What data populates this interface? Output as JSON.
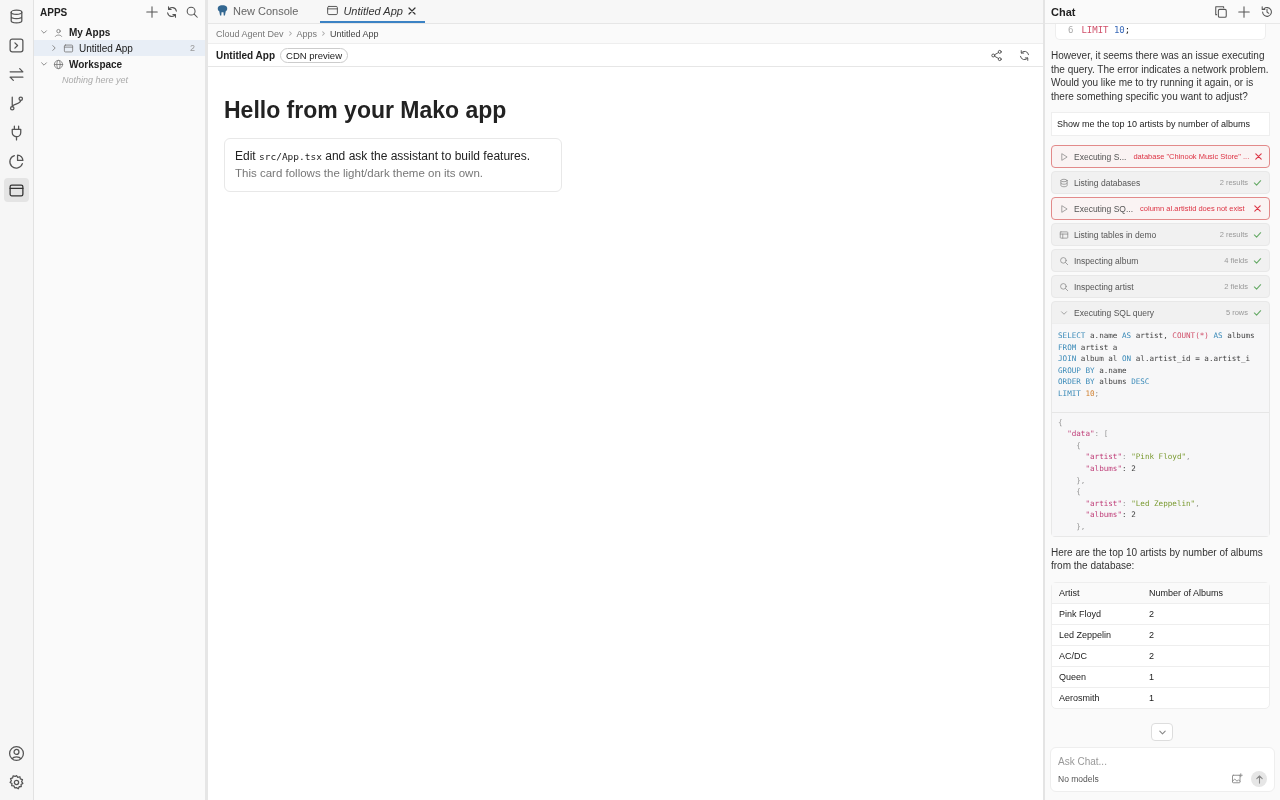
{
  "activity_bar": {
    "items": [
      {
        "kind": "database",
        "selected": false
      },
      {
        "kind": "terminal",
        "selected": false
      },
      {
        "kind": "transfer",
        "selected": false
      },
      {
        "kind": "branch",
        "selected": false
      },
      {
        "kind": "plug",
        "selected": false
      },
      {
        "kind": "chart",
        "selected": false
      },
      {
        "kind": "window",
        "selected": true
      }
    ]
  },
  "sidebar": {
    "title": "APPS",
    "tree": [
      {
        "label": "My Apps",
        "kind": "user",
        "expanded": true,
        "children": [
          {
            "label": "Untitled App",
            "kind": "window",
            "count": "2",
            "expanded": false,
            "selected": true
          }
        ]
      },
      {
        "label": "Workspace",
        "kind": "globe",
        "expanded": true,
        "empty_text": "Nothing here yet"
      }
    ]
  },
  "tabs": [
    {
      "label": "New Console",
      "kind": "logo",
      "selected": false,
      "closable": false
    },
    {
      "label": "Untitled App",
      "kind": "window",
      "selected": true,
      "closable": true
    }
  ],
  "breadcrumb": [
    "Cloud Agent Dev",
    "Apps",
    "Untitled App"
  ],
  "app_header": {
    "title": "Untitled App",
    "badge": "CDN preview"
  },
  "preview": {
    "heading": "Hello from your Mako app",
    "card_line": [
      {
        "text": "Edit ",
        "kind": "text"
      },
      {
        "text": "src/App.tsx",
        "kind": "code"
      },
      {
        "text": " and ask the assistant to build features.",
        "kind": "text"
      }
    ],
    "card_note": "This card follows the light/dark theme on its own."
  },
  "chat": {
    "title": "Chat",
    "top_code": [
      {
        "number": "6",
        "tokens": [
          {
            "text": "LIMIT ",
            "kind": "function"
          },
          {
            "text": "10",
            "kind": "literal"
          },
          {
            "text": ";",
            "kind": "plain"
          }
        ]
      }
    ],
    "reply": "However, it seems there was an issue executing the query. The error indicates a network problem. Would you like me to try running it again, or is there something specific you want to adjust?",
    "user_message": "Show me the top 10 artists by number of albums",
    "steps": [
      {
        "kind": "play",
        "label": "Executing S...",
        "detail": "database \"Chinook Music Store\" ...",
        "failed": true,
        "expanded": false
      },
      {
        "kind": "database",
        "label": "Listing databases",
        "detail": "2 results",
        "failed": false,
        "expanded": false
      },
      {
        "kind": "play",
        "label": "Executing SQ...",
        "detail": "column al.artistid does not exist",
        "failed": true,
        "expanded": false
      },
      {
        "kind": "table",
        "label": "Listing tables in demo",
        "detail": "2 results",
        "failed": false,
        "expanded": false
      },
      {
        "kind": "search",
        "label": "Inspecting album",
        "detail": "4 fields",
        "failed": false,
        "expanded": false
      },
      {
        "kind": "search",
        "label": "Inspecting artist",
        "detail": "2 fields",
        "failed": false,
        "expanded": false
      },
      {
        "kind": "chevron",
        "label": "Executing SQL query",
        "detail": "5 rows",
        "failed": false,
        "expanded": true
      }
    ],
    "query": [
      [
        {
          "text": "SELECT",
          "kind": "keyword"
        },
        {
          "text": " a.name ",
          "kind": "plain"
        },
        {
          "text": "AS",
          "kind": "keyword"
        },
        {
          "text": " artist, ",
          "kind": "plain"
        },
        {
          "text": "COUNT(*) ",
          "kind": "function"
        },
        {
          "text": "AS",
          "kind": "keyword"
        },
        {
          "text": " albums",
          "kind": "plain"
        }
      ],
      [
        {
          "text": "FROM",
          "kind": "keyword"
        },
        {
          "text": " artist a",
          "kind": "plain"
        }
      ],
      [
        {
          "text": "JOIN",
          "kind": "keyword"
        },
        {
          "text": " album al ",
          "kind": "plain"
        },
        {
          "text": "ON",
          "kind": "keyword"
        },
        {
          "text": " al.artist_id = a.artist_i",
          "kind": "plain"
        }
      ],
      [
        {
          "text": "GROUP BY",
          "kind": "keyword"
        },
        {
          "text": " a.name",
          "kind": "plain"
        }
      ],
      [
        {
          "text": "ORDER BY",
          "kind": "keyword"
        },
        {
          "text": " albums ",
          "kind": "plain"
        },
        {
          "text": "DESC",
          "kind": "keyword"
        }
      ],
      [
        {
          "text": "LIMIT ",
          "kind": "keyword"
        },
        {
          "text": "10",
          "kind": "number"
        },
        {
          "text": ";",
          "kind": "punct"
        }
      ]
    ],
    "result": [
      [
        {
          "text": "{",
          "kind": "punct"
        }
      ],
      [
        {
          "text": "  \"data\"",
          "kind": "key"
        },
        {
          "text": ": [",
          "kind": "punct"
        }
      ],
      [
        {
          "text": "    {",
          "kind": "punct"
        }
      ],
      [
        {
          "text": "      \"artist\"",
          "kind": "key"
        },
        {
          "text": ": ",
          "kind": "punct"
        },
        {
          "text": "\"Pink Floyd\"",
          "kind": "string"
        },
        {
          "text": ",",
          "kind": "punct"
        }
      ],
      [
        {
          "text": "      \"albums\"",
          "kind": "key"
        },
        {
          "text": ": 2",
          "kind": "plain"
        }
      ],
      [
        {
          "text": "    },",
          "kind": "punct"
        }
      ],
      [
        {
          "text": "    {",
          "kind": "punct"
        }
      ],
      [
        {
          "text": "      \"artist\"",
          "kind": "key"
        },
        {
          "text": ": ",
          "kind": "punct"
        },
        {
          "text": "\"Led Zeppelin\"",
          "kind": "string"
        },
        {
          "text": ",",
          "kind": "punct"
        }
      ],
      [
        {
          "text": "      \"albums\"",
          "kind": "key"
        },
        {
          "text": ": 2",
          "kind": "plain"
        }
      ],
      [
        {
          "text": "    },",
          "kind": "punct"
        }
      ]
    ],
    "summary": "Here are the top 10 artists by number of albums from the database:",
    "table": {
      "columns": [
        "Artist",
        "Number of Albums"
      ],
      "rows": [
        [
          "Pink Floyd",
          "2"
        ],
        [
          "Led Zeppelin",
          "2"
        ],
        [
          "AC/DC",
          "2"
        ],
        [
          "Queen",
          "1"
        ],
        [
          "Aerosmith",
          "1"
        ]
      ]
    },
    "input": {
      "placeholder": "Ask Chat...",
      "model": "No models"
    }
  }
}
